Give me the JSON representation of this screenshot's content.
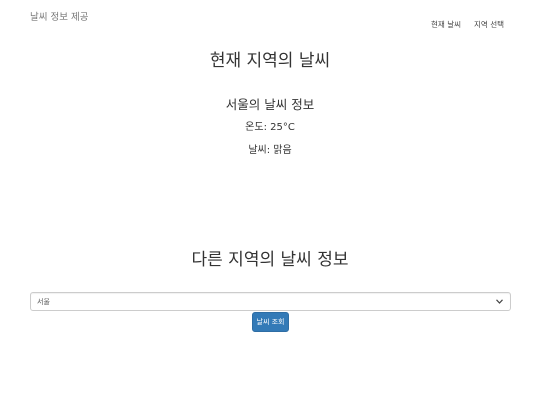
{
  "header": {
    "brand": "날씨 정보 제공",
    "nav": [
      {
        "label": "현재 날씨"
      },
      {
        "label": "지역 선택"
      }
    ]
  },
  "current": {
    "title": "현재 지역의 날씨",
    "city_title": "서울의 날씨 정보",
    "temperature": "온도: 25°C",
    "condition": "날씨: 맑음"
  },
  "other": {
    "title": "다른 지역의 날씨 정보",
    "select_value": "서울",
    "button_label": "날씨 조회"
  },
  "colors": {
    "primary_button": "#337ab7",
    "text": "#333333",
    "brand": "#777777"
  },
  "icons": {
    "select_chevron": "chevron-down-icon"
  }
}
